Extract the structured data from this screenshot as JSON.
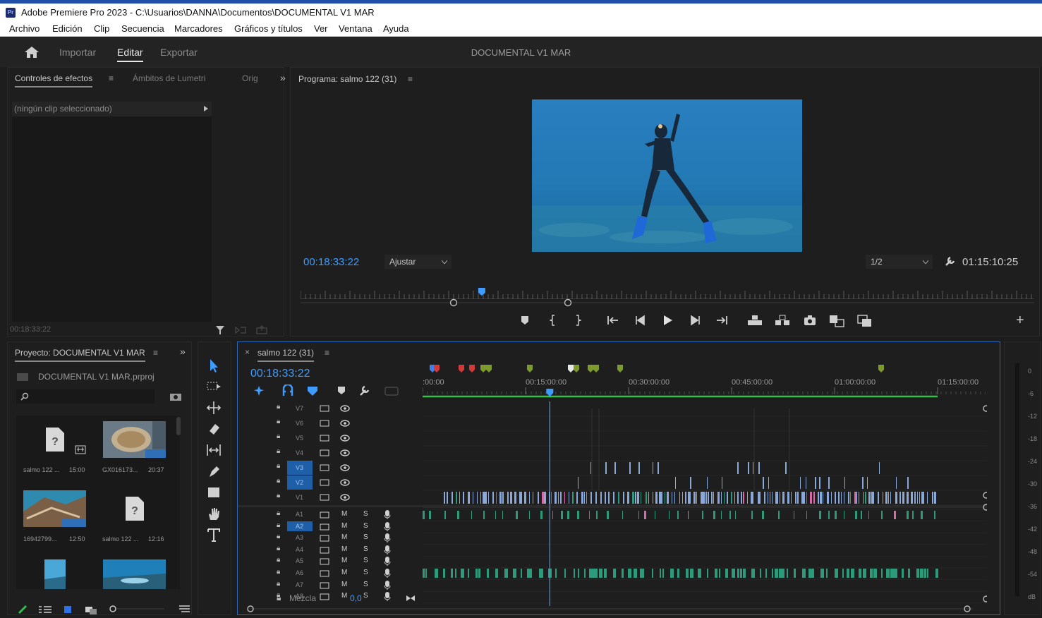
{
  "window": {
    "title": "Adobe Premiere Pro 2023 - C:\\Usuarios\\DANNA\\Documentos\\DOCUMENTAL V1 MAR",
    "app_icon": "Pr"
  },
  "menu": [
    "Archivo",
    "Edición",
    "Clip",
    "Secuencia",
    "Marcadores",
    "Gráficos y títulos",
    "Ver",
    "Ventana",
    "Ayuda"
  ],
  "workspace": {
    "tabs": [
      "Importar",
      "Editar",
      "Exportar"
    ],
    "active": "Editar",
    "project_name": "DOCUMENTAL V1 MAR"
  },
  "effect_controls": {
    "tabs": [
      "Controles de efectos",
      "Ámbitos de Lumetri",
      "Orig"
    ],
    "menu_glyph": "≡",
    "more_glyph": "»",
    "no_clip": "(ningún clip seleccionado)",
    "timecode": "00:18:33:22"
  },
  "program_monitor": {
    "title": "Programa: salmo 122 (31)",
    "menu_glyph": "≡",
    "timecode": "00:18:33:22",
    "fit": "Ajustar",
    "resolution": "1/2",
    "duration": "01:15:10:25",
    "playhead_fraction": 0.247
  },
  "project": {
    "title": "Proyecto: DOCUMENTAL V1 MAR",
    "menu_glyph": "≡",
    "file": "DOCUMENTAL V1 MAR.prproj",
    "items": [
      {
        "name": "salmo 122 ...",
        "duration": "15:00"
      },
      {
        "name": "GX016173...",
        "duration": "20:37"
      },
      {
        "name": "16942799...",
        "duration": "12:50"
      },
      {
        "name": "salmo 122 ...",
        "duration": "12:16"
      }
    ]
  },
  "timeline": {
    "sequence": "salmo 122 (31)",
    "close_glyph": "×",
    "menu_glyph": "≡",
    "timecode": "00:18:33:22",
    "ruler_labels": [
      ":00:00",
      "00:15:00:00",
      "00:30:00:00",
      "00:45:00:00",
      "01:00:00:00",
      "01:15:00:00"
    ],
    "video_tracks": [
      "V7",
      "V6",
      "V5",
      "V4",
      "V3",
      "V2",
      "V1"
    ],
    "audio_tracks": [
      "A1",
      "A2",
      "A3",
      "A4",
      "A5",
      "A6",
      "A7",
      "A8"
    ],
    "mute_label": "M",
    "solo_label": "S",
    "mix_label": "Mezcla",
    "mix_value": "0,0",
    "playhead_fraction": 0.247
  },
  "meter": {
    "labels": [
      "0",
      "-6",
      "-12",
      "-18",
      "-24",
      "-30",
      "-36",
      "-42",
      "-48",
      "-54",
      "dB"
    ]
  },
  "colors": {
    "accent": "#3f9cff",
    "timeline_border": "#2f66b3",
    "audio_clip": "#2e9a7c",
    "video_clip": "#8aa8d8",
    "marker_green": "#7c9a2e",
    "marker_red": "#d23a3a"
  },
  "icons": [
    "home-icon",
    "wrench-icon",
    "selection-tool-icon",
    "hand-icon",
    "type-tool-icon",
    "play-icon",
    "camera-icon",
    "filter-icon",
    "search-icon"
  ]
}
